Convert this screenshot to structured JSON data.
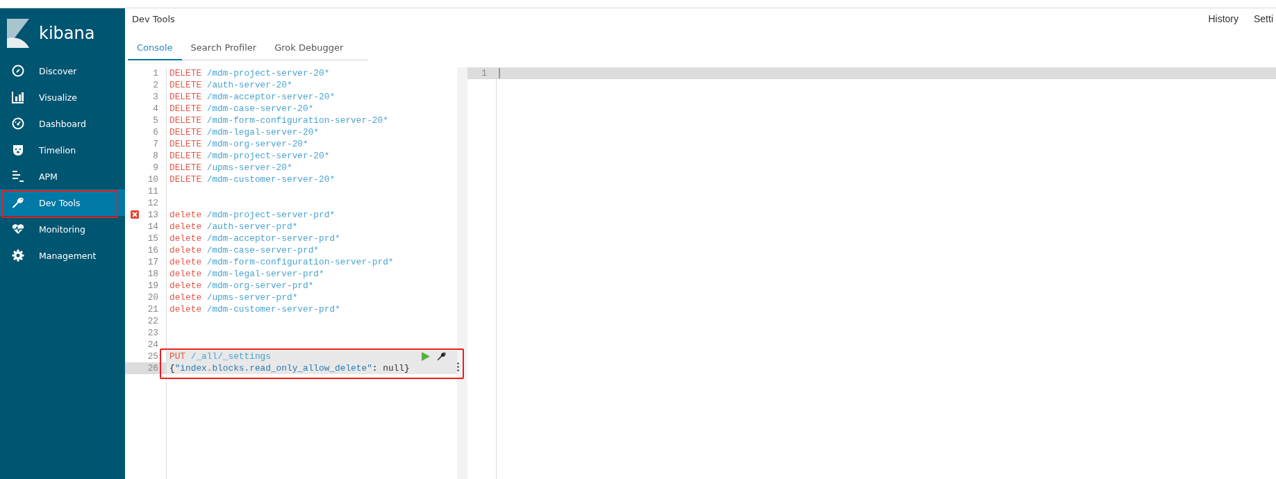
{
  "sidebar": {
    "logo": "kibana",
    "items": [
      {
        "label": "Discover",
        "selected": false
      },
      {
        "label": "Visualize",
        "selected": false
      },
      {
        "label": "Dashboard",
        "selected": false
      },
      {
        "label": "Timelion",
        "selected": false
      },
      {
        "label": "APM",
        "selected": false
      },
      {
        "label": "Dev Tools",
        "selected": true
      },
      {
        "label": "Monitoring",
        "selected": false
      },
      {
        "label": "Management",
        "selected": false
      }
    ]
  },
  "header": {
    "title": "Dev Tools",
    "links": [
      "History",
      "Setti"
    ]
  },
  "tabs": [
    {
      "label": "Console",
      "selected": true
    },
    {
      "label": "Search Profiler",
      "selected": false
    },
    {
      "label": "Grok Debugger",
      "selected": false
    }
  ],
  "editor": {
    "lines": [
      {
        "number": "1",
        "tokens": [
          {
            "kind": "method",
            "text": "DELETE"
          },
          {
            "kind": "path",
            "text": "/mdm-project-server-20*"
          }
        ]
      },
      {
        "number": "2",
        "tokens": [
          {
            "kind": "method",
            "text": "DELETE"
          },
          {
            "kind": "path",
            "text": "/auth-server-20*"
          }
        ]
      },
      {
        "number": "3",
        "tokens": [
          {
            "kind": "method",
            "text": "DELETE"
          },
          {
            "kind": "path",
            "text": "/mdm-acceptor-server-20*"
          }
        ]
      },
      {
        "number": "4",
        "tokens": [
          {
            "kind": "method",
            "text": "DELETE"
          },
          {
            "kind": "path",
            "text": "/mdm-case-server-20*"
          }
        ]
      },
      {
        "number": "5",
        "tokens": [
          {
            "kind": "method",
            "text": "DELETE"
          },
          {
            "kind": "path",
            "text": "/mdm-form-configuration-server-20*"
          }
        ]
      },
      {
        "number": "6",
        "tokens": [
          {
            "kind": "method",
            "text": "DELETE"
          },
          {
            "kind": "path",
            "text": "/mdm-legal-server-20*"
          }
        ]
      },
      {
        "number": "7",
        "tokens": [
          {
            "kind": "method",
            "text": "DELETE"
          },
          {
            "kind": "path",
            "text": "/mdm-org-server-20*"
          }
        ]
      },
      {
        "number": "8",
        "tokens": [
          {
            "kind": "method",
            "text": "DELETE"
          },
          {
            "kind": "path",
            "text": "/mdm-project-server-20*"
          }
        ]
      },
      {
        "number": "9",
        "tokens": [
          {
            "kind": "method",
            "text": "DELETE"
          },
          {
            "kind": "path",
            "text": "/upms-server-20*"
          }
        ]
      },
      {
        "number": "10",
        "tokens": [
          {
            "kind": "method",
            "text": "DELETE"
          },
          {
            "kind": "path",
            "text": "/mdm-customer-server-20*"
          }
        ]
      },
      {
        "number": "11"
      },
      {
        "number": "12"
      },
      {
        "number": "13",
        "error": true,
        "tokens": [
          {
            "kind": "method",
            "text": "delete"
          },
          {
            "kind": "path",
            "text": "/mdm-project-server-prd*"
          }
        ]
      },
      {
        "number": "14",
        "tokens": [
          {
            "kind": "method",
            "text": "delete"
          },
          {
            "kind": "path",
            "text": "/auth-server-prd*"
          }
        ]
      },
      {
        "number": "15",
        "tokens": [
          {
            "kind": "method",
            "text": "delete"
          },
          {
            "kind": "path",
            "text": "/mdm-acceptor-server-prd*"
          }
        ]
      },
      {
        "number": "16",
        "tokens": [
          {
            "kind": "method",
            "text": "delete"
          },
          {
            "kind": "path",
            "text": "/mdm-case-server-prd*"
          }
        ]
      },
      {
        "number": "17",
        "tokens": [
          {
            "kind": "method",
            "text": "delete"
          },
          {
            "kind": "path",
            "text": "/mdm-form-configuration-server-prd*"
          }
        ]
      },
      {
        "number": "18",
        "tokens": [
          {
            "kind": "method",
            "text": "delete"
          },
          {
            "kind": "path",
            "text": "/mdm-legal-server-prd*"
          }
        ]
      },
      {
        "number": "19",
        "tokens": [
          {
            "kind": "method",
            "text": "delete"
          },
          {
            "kind": "path",
            "text": "/mdm-org-server-prd*"
          }
        ]
      },
      {
        "number": "20",
        "tokens": [
          {
            "kind": "method",
            "text": "delete"
          },
          {
            "kind": "path",
            "text": "/upms-server-prd*"
          }
        ]
      },
      {
        "number": "21",
        "tokens": [
          {
            "kind": "method",
            "text": "delete"
          },
          {
            "kind": "path",
            "text": "/mdm-customer-server-prd*"
          }
        ]
      },
      {
        "number": "22"
      },
      {
        "number": "23"
      },
      {
        "number": "24"
      },
      {
        "number": "25",
        "in_request": true,
        "actions": true,
        "tokens": [
          {
            "kind": "method",
            "text": "PUT"
          },
          {
            "kind": "path",
            "text": "/_all/_settings"
          }
        ]
      },
      {
        "number": "26",
        "in_request": true,
        "active": true,
        "tokens": [
          {
            "kind": "punct",
            "text": "{"
          },
          {
            "kind": "string",
            "text": "\"index.blocks.read_only_allow_delete\""
          },
          {
            "kind": "punct",
            "text": ":"
          },
          {
            "kind": "literal",
            "text": "null"
          },
          {
            "kind": "punct",
            "text": "}"
          }
        ]
      }
    ]
  },
  "output": {
    "lines": [
      {
        "number": "1",
        "active": true
      }
    ]
  }
}
